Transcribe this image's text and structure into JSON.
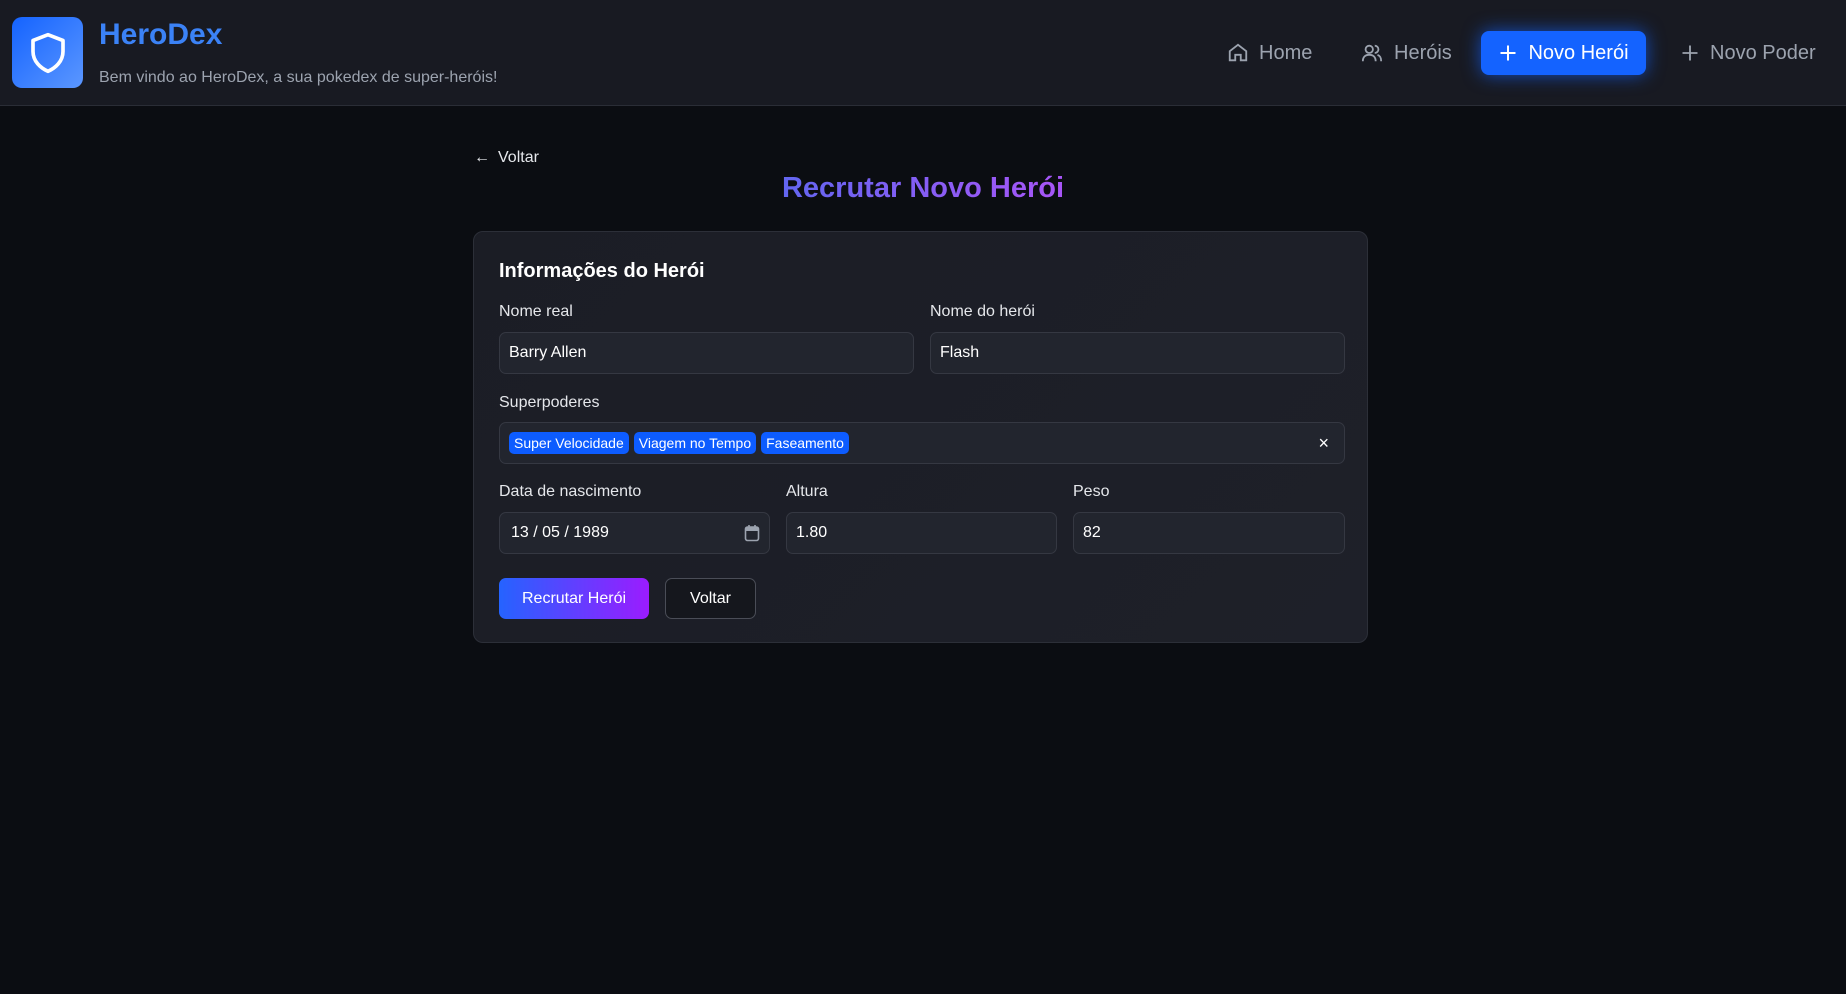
{
  "header": {
    "brand": "HeroDex",
    "tagline": "Bem vindo ao HeroDex, a sua pokedex de super-heróis!",
    "nav": [
      {
        "label": "Home",
        "icon": "home-icon"
      },
      {
        "label": "Heróis",
        "icon": "users-icon"
      },
      {
        "label": "Novo Herói",
        "icon": "plus-icon",
        "active": true
      },
      {
        "label": "Novo Poder",
        "icon": "plus-icon"
      }
    ]
  },
  "page": {
    "back_label": "Voltar",
    "title": "Recrutar Novo Herói"
  },
  "form": {
    "heading": "Informações do Herói",
    "real_name": {
      "label": "Nome real",
      "value": "Barry Allen"
    },
    "hero_name": {
      "label": "Nome do herói",
      "value": "Flash"
    },
    "powers": {
      "label": "Superpoderes",
      "selected": [
        "Super Velocidade",
        "Viagem no Tempo",
        "Faseamento"
      ],
      "clear": "×"
    },
    "birth": {
      "label": "Data de nascimento",
      "value": "13 / 05 / 1989"
    },
    "height": {
      "label": "Altura",
      "value": "1.80"
    },
    "weight": {
      "label": "Peso",
      "value": "82"
    },
    "submit": "Recrutar Herói",
    "cancel": "Voltar"
  },
  "colors": {
    "accent": "#1463ff",
    "brand": "#3b82f6",
    "title_gradient": [
      "#6366f1",
      "#a855f7"
    ],
    "chip": "#0d5cff"
  }
}
